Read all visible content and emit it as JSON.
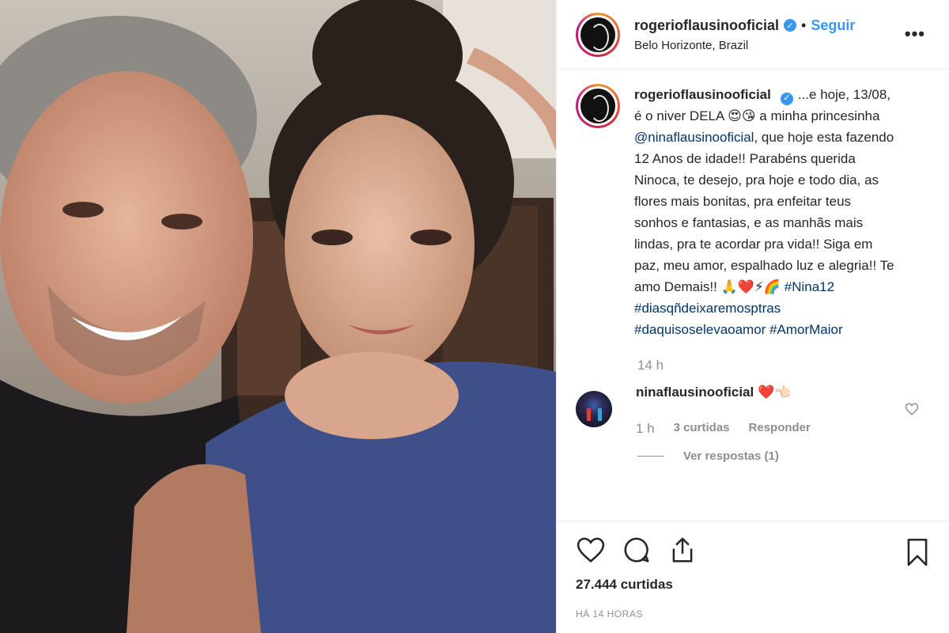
{
  "post": {
    "username": "rogerioflausinooficial",
    "follow_label": "Seguir",
    "dot": "•",
    "location": "Belo Horizonte, Brazil",
    "more": "•••",
    "verified_mark": "✓",
    "caption": {
      "text_1": "...e hoje, 13/08, é o niver DELA 😍😘 a minha princesinha ",
      "mention": "@ninaflausinooficial",
      "text_2": ", que hoje esta fazendo 12 Anos de idade!! Parabéns querida Ninoca, te desejo, pra hoje e todo dia, as flores mais bonitas, pra enfeitar teus sonhos e fantasias, e as manhãs mais lindas, pra te acordar pra vida!! Siga em paz, meu amor, espalhado luz e alegria!! Te amo Demais!! 🙏❤️⚡🌈 ",
      "hashtag_1": "#Nina12",
      "hashtag_2": "#diasqñdeixaremosptras",
      "hashtag_3": "#daquisoselevaoamor",
      "hashtag_4": "#AmorMaior"
    },
    "caption_time": "14 h",
    "reply": {
      "username": "ninaflausinooficial",
      "text": "❤️👈🏻",
      "time": "1 h",
      "likes": "3 curtidas",
      "respond": "Responder",
      "view_replies": "Ver respostas (1)"
    },
    "likes": "27.444 curtidas",
    "timestamp": "HÁ 14 HORAS"
  },
  "icons": {
    "like": "heart-icon",
    "comment": "comment-icon",
    "share": "share-icon",
    "save": "bookmark-icon"
  },
  "colors": {
    "accent": "#3897f0",
    "link": "#003569",
    "muted": "#8e8e8e"
  }
}
